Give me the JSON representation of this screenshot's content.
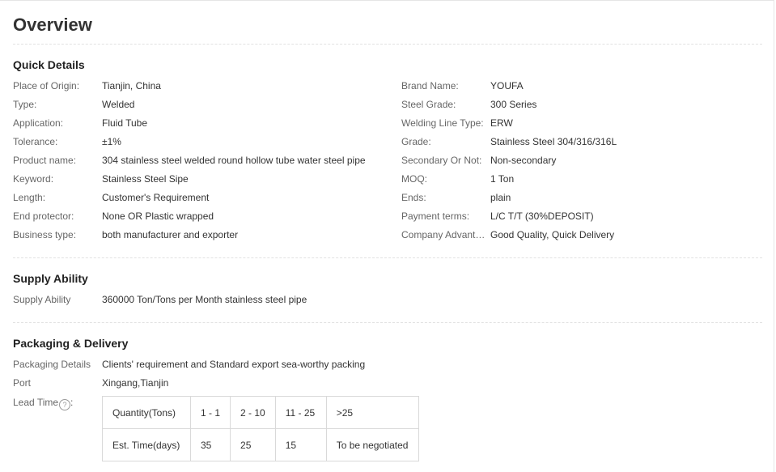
{
  "overview": {
    "title": "Overview"
  },
  "quick_details": {
    "title": "Quick Details",
    "left": [
      {
        "label": "Place of Origin:",
        "value": "Tianjin, China"
      },
      {
        "label": "Type:",
        "value": "Welded"
      },
      {
        "label": "Application:",
        "value": "Fluid Tube"
      },
      {
        "label": "Tolerance:",
        "value": "±1%"
      },
      {
        "label": "Product name:",
        "value": "304 stainless steel welded round hollow tube water steel pipe"
      },
      {
        "label": "Keyword:",
        "value": "Stainless Steel Sipe"
      },
      {
        "label": "Length:",
        "value": "Customer's Requirement"
      },
      {
        "label": "End protector:",
        "value": "None OR Plastic wrapped"
      },
      {
        "label": "Business type:",
        "value": "both manufacturer and exporter"
      }
    ],
    "right": [
      {
        "label": "Brand Name:",
        "value": "YOUFA"
      },
      {
        "label": "Steel Grade:",
        "value": "300 Series"
      },
      {
        "label": "Welding Line Type:",
        "value": "ERW"
      },
      {
        "label": "Grade:",
        "value": "Stainless Steel 304/316/316L"
      },
      {
        "label": "Secondary Or Not:",
        "value": "Non-secondary"
      },
      {
        "label": "MOQ:",
        "value": "1 Ton"
      },
      {
        "label": "Ends:",
        "value": "plain"
      },
      {
        "label": "Payment terms:",
        "value": "L/C T/T (30%DEPOSIT)"
      },
      {
        "label": "Company Advanta...",
        "value": "Good Quality, Quick Delivery"
      }
    ]
  },
  "supply_ability": {
    "title": "Supply Ability",
    "label": "Supply Ability",
    "value": "360000 Ton/Tons per Month stainless steel pipe"
  },
  "packaging_delivery": {
    "title": "Packaging & Delivery",
    "packaging_label": "Packaging Details",
    "packaging_value": "Clients' requirement and Standard export sea-worthy packing",
    "port_label": "Port",
    "port_value": "Xingang,Tianjin",
    "lead_time_label": "Lead Time",
    "help_icon_glyph": "?",
    "lead_time_table": {
      "rows": [
        [
          "Quantity(Tons)",
          "1 - 1",
          "2 - 10",
          "11 - 25",
          ">25"
        ],
        [
          "Est. Time(days)",
          "35",
          "25",
          "15",
          "To be negotiated"
        ]
      ]
    }
  }
}
